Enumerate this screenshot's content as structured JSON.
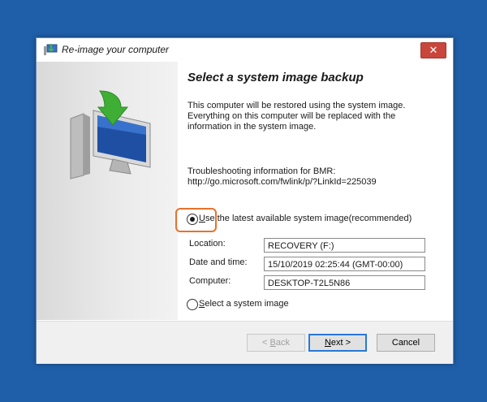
{
  "window": {
    "title": "Re-image your computer",
    "close_glyph": "✕"
  },
  "content": {
    "heading": "Select a system image backup",
    "description": "This computer will be restored using the system image. Everything on this computer will be replaced with the information in the system image.",
    "troubleshoot_label": "Troubleshooting information for BMR:",
    "troubleshoot_link": "http://go.microsoft.com/fwlink/p/?LinkId=225039"
  },
  "options": {
    "latest": {
      "accel": "U",
      "rest": "se the latest available system image(recommended)",
      "selected": true
    },
    "select": {
      "accel": "S",
      "rest": "elect a system image",
      "selected": false
    }
  },
  "details": {
    "location_label": "Location:",
    "location_value": "RECOVERY (F:)",
    "datetime_label": "Date and time:",
    "datetime_value": "15/10/2019 02:25:44 (GMT-00:00)",
    "computer_label": "Computer:",
    "computer_value": "DESKTOP-T2L5N86"
  },
  "buttons": {
    "back_prefix": "< ",
    "back_accel": "B",
    "back_rest": "ack",
    "next_accel": "N",
    "next_rest": "ext >",
    "cancel": "Cancel"
  },
  "colors": {
    "desktop": "#1f5fa9",
    "highlight": "#e8722c",
    "close": "#c9463d",
    "default_button": "#2a78d6"
  },
  "icons": {
    "title": "restore-computer-icon",
    "side": "computer-restore-illustration"
  }
}
